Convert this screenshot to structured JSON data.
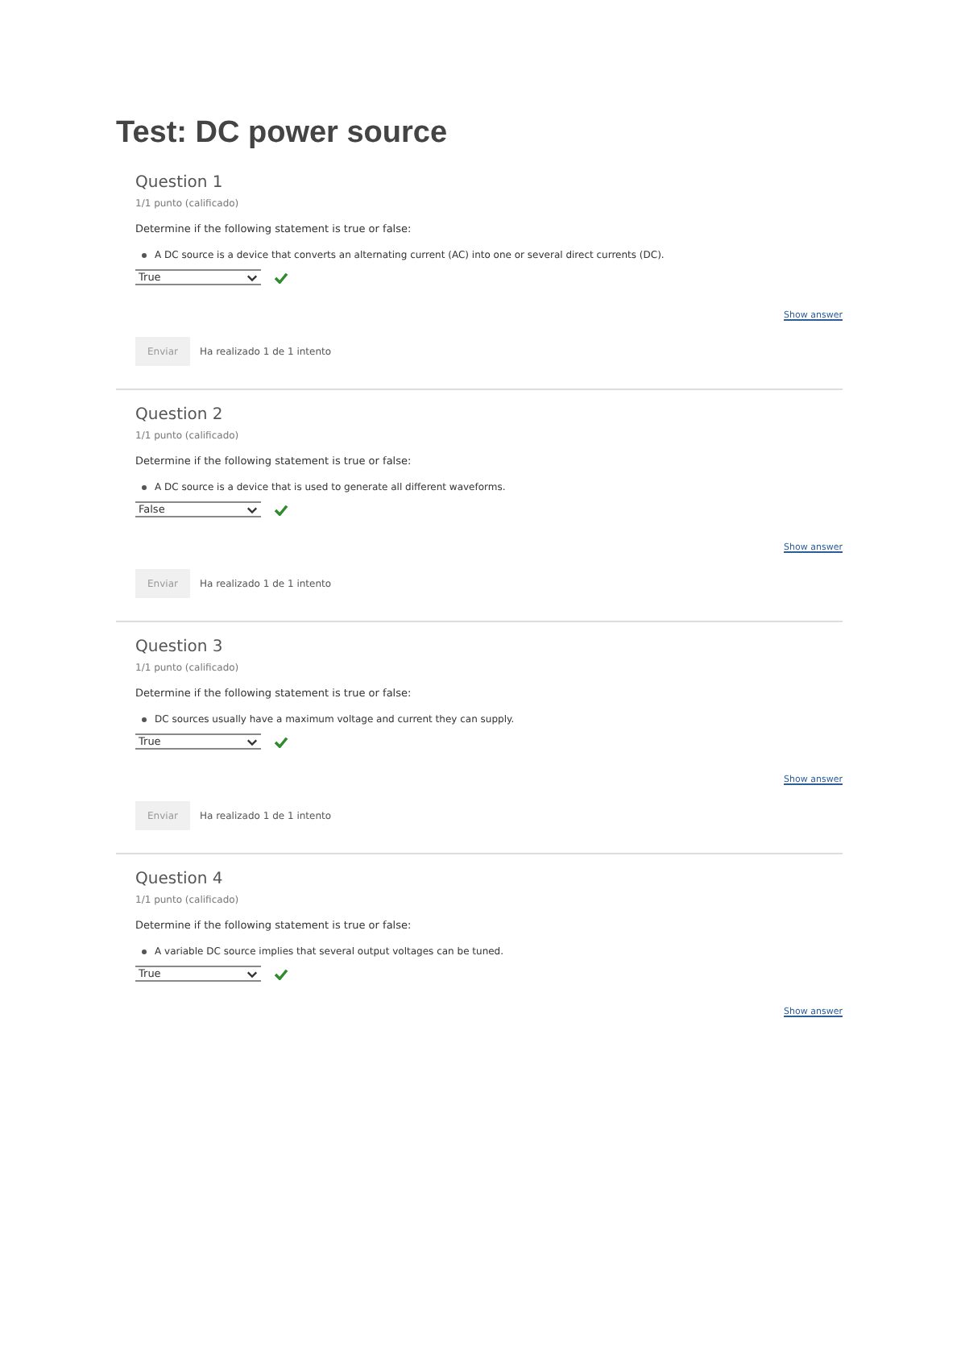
{
  "title": "Test: DC power source",
  "questions": [
    {
      "heading": "Question 1",
      "points": "1/1 punto (calificado)",
      "prompt": "Determine if the following statement is true or false:",
      "statement": "A DC source is a device that converts an alternating current (AC) into one or several direct currents (DC).",
      "answer": "True",
      "correct": true,
      "link": "Show answer",
      "submit": {
        "label": "Enviar",
        "disabled": true,
        "note": "Ha realizado 1 de 1 intento"
      }
    },
    {
      "heading": "Question 2",
      "points": "1/1 punto (calificado)",
      "prompt": "Determine if the following statement is true or false:",
      "statement": "A DC source is a device that is used to generate all different waveforms.",
      "answer": "False",
      "correct": true,
      "link": "Show answer",
      "submit": {
        "label": "Enviar",
        "disabled": true,
        "note": "Ha realizado 1 de 1 intento"
      }
    },
    {
      "heading": "Question 3",
      "points": "1/1 punto (calificado)",
      "prompt": "Determine if the following statement is true or false:",
      "statement": "DC sources usually have a maximum voltage and current they can supply.",
      "answer": "True",
      "correct": true,
      "link": "Show answer",
      "submit": {
        "label": "Enviar",
        "disabled": true,
        "note": "Ha realizado 1 de 1 intento"
      }
    },
    {
      "heading": "Question 4",
      "points": "1/1 punto (calificado)",
      "prompt": "Determine if the following statement is true or false:",
      "statement": "A variable DC source implies that several output voltages can be tuned.",
      "answer": "True",
      "correct": true,
      "link": "Show answer"
    }
  ]
}
